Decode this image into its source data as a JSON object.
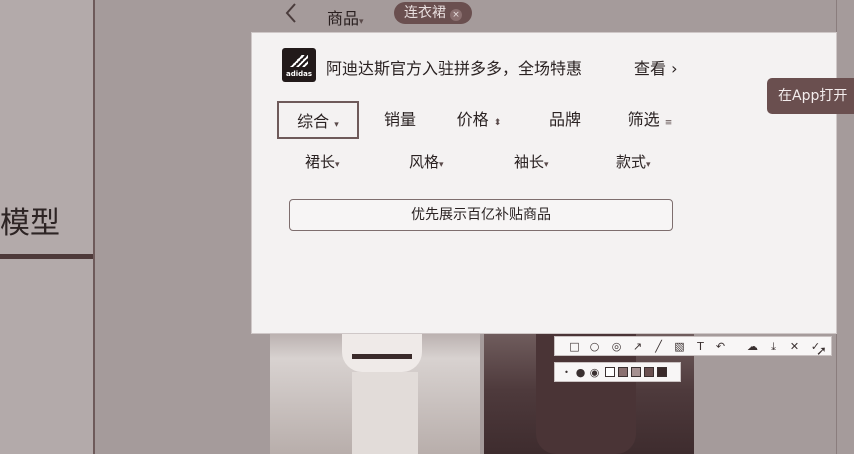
{
  "left": {
    "text": "模型"
  },
  "nav": {
    "goods": "商品",
    "goods_caret": "▾",
    "search_chip": "连衣裙",
    "back_icon": "back-icon"
  },
  "banner": {
    "logo_word": "adidas",
    "text": "阿迪达斯官方入驻拼多多，全场特惠",
    "view": "查看"
  },
  "sort_tabs": [
    {
      "label": "综合",
      "suffix": "▾"
    },
    {
      "label": "销量",
      "suffix": ""
    },
    {
      "label": "价格",
      "suffix": "⬍"
    },
    {
      "label": "品牌",
      "suffix": ""
    },
    {
      "label": "筛选",
      "suffix": "≡"
    }
  ],
  "filters": [
    {
      "label": "裙长",
      "suffix": "▾"
    },
    {
      "label": "风格",
      "suffix": "▾"
    },
    {
      "label": "袖长",
      "suffix": "▾"
    },
    {
      "label": "款式",
      "suffix": "▾"
    }
  ],
  "subsidy_button": "优先展示百亿补贴商品",
  "app_button": "在App打开",
  "colors": {
    "accent": "#6a4f4f",
    "panel": "#f4f2f2",
    "backdrop": "#a59b9b"
  }
}
